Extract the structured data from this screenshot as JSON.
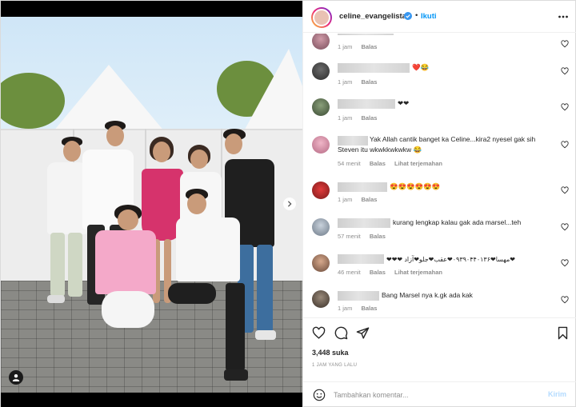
{
  "header": {
    "username": "celine_evangelista",
    "verified_icon": "verified-badge-icon",
    "separator": "•",
    "follow_label": "Ikuti",
    "more_icon": "more-options-icon"
  },
  "comments": [
    {
      "text": "",
      "meta": [
        "1 jam",
        "Balas"
      ]
    },
    {
      "text": "❤️😂",
      "meta": [
        "1 jam",
        "Balas"
      ]
    },
    {
      "text": "❤❤",
      "meta": [
        "1 jam",
        "Balas"
      ]
    },
    {
      "text": "Yak Allah cantik banget ka Celine...kira2 nyesel gak sih Steven itu wkwkkwkwkw 😂",
      "meta": [
        "54 menit",
        "Balas",
        "Lihat terjemahan"
      ]
    },
    {
      "text": "😍😍😍😍😍😍",
      "meta": [
        "1 jam",
        "Balas"
      ]
    },
    {
      "text": "kurang lengkap kalau gak ada marsel...teh",
      "meta": [
        "57 menit",
        "Balas"
      ]
    },
    {
      "text": "❤❤❤ مهسا❤۰۹۳۹۰۴۴۰۱۳۶❤عقب❤جلو❤آزاد❤",
      "meta": [
        "46 menit",
        "Balas",
        "Lihat terjemahan"
      ]
    },
    {
      "text": "Bang Marsel nya k.gk ada kak",
      "meta": [
        "1 jam",
        "Balas"
      ]
    }
  ],
  "actions": {
    "likes": "3,448 suka",
    "time": "1 JAM YANG LALU"
  },
  "composer": {
    "placeholder": "Tambahkan komentar...",
    "post_label": "Kirim"
  },
  "colors": {
    "accent": "#0095f6",
    "muted": "#8e8e8e",
    "text": "#262626",
    "post_disabled": "#b3dbff"
  }
}
